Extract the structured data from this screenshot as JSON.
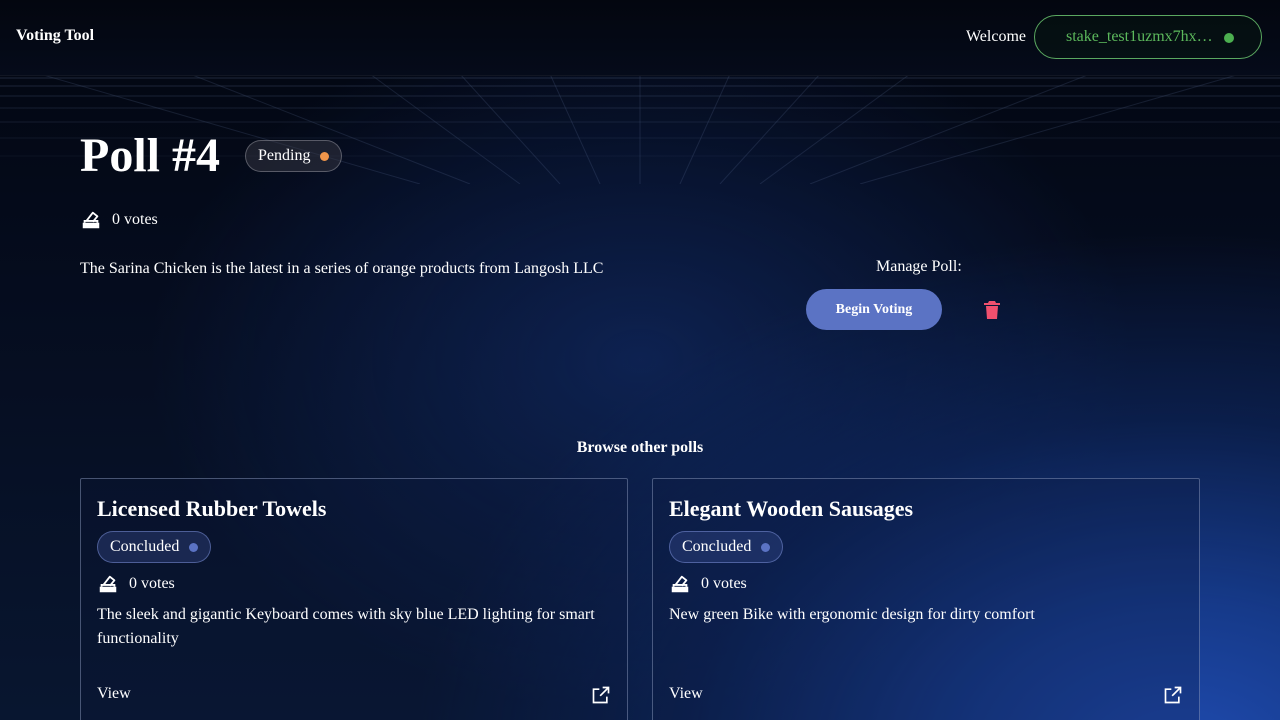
{
  "header": {
    "brand": "Voting Tool",
    "welcome": "Welcome",
    "wallet_address": "stake_test1uzmx7hx…",
    "wallet_status_color": "#4caf50"
  },
  "poll": {
    "title": "Poll #4",
    "status": "Pending",
    "status_color": "#f0954a",
    "votes": "0 votes",
    "description": "The Sarina Chicken is the latest in a series of orange products from Langosh LLC"
  },
  "manage": {
    "label": "Manage Poll:",
    "begin_button": "Begin Voting",
    "delete_icon": "trash-icon",
    "delete_color": "#f0506e"
  },
  "browse": {
    "title": "Browse other polls",
    "cards": [
      {
        "title": "Licensed Rubber Towels",
        "status": "Concluded",
        "status_color": "#5b73c4",
        "votes": "0 votes",
        "description": "The sleek and gigantic Keyboard comes with sky blue LED lighting for smart functionality",
        "view_label": "View",
        "icon": "external-link-icon"
      },
      {
        "title": "Elegant Wooden Sausages",
        "status": "Concluded",
        "status_color": "#5b73c4",
        "votes": "0 votes",
        "description": "New green Bike with ergonomic design for dirty comfort",
        "view_label": "View",
        "icon": "external-link-icon"
      }
    ]
  },
  "icons": {
    "votes": "ballot-box-icon"
  }
}
